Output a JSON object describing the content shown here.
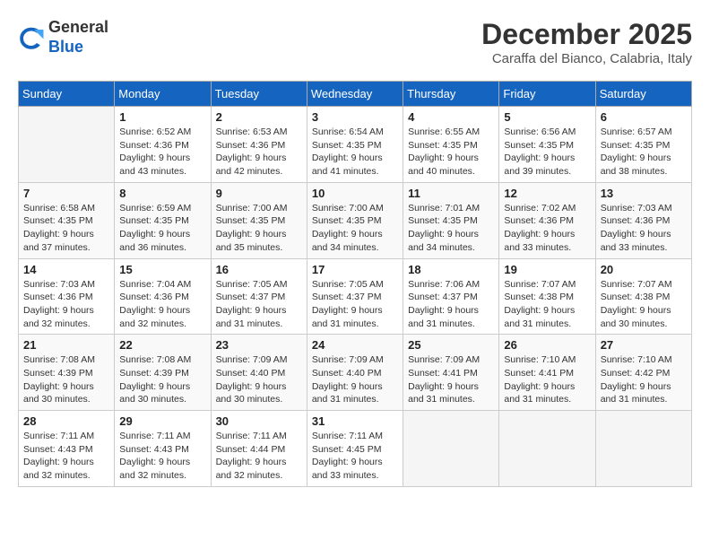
{
  "header": {
    "logo_general": "General",
    "logo_blue": "Blue",
    "month_year": "December 2025",
    "location": "Caraffa del Bianco, Calabria, Italy"
  },
  "weekdays": [
    "Sunday",
    "Monday",
    "Tuesday",
    "Wednesday",
    "Thursday",
    "Friday",
    "Saturday"
  ],
  "weeks": [
    [
      {
        "day": "",
        "info": ""
      },
      {
        "day": "1",
        "info": "Sunrise: 6:52 AM\nSunset: 4:36 PM\nDaylight: 9 hours\nand 43 minutes."
      },
      {
        "day": "2",
        "info": "Sunrise: 6:53 AM\nSunset: 4:36 PM\nDaylight: 9 hours\nand 42 minutes."
      },
      {
        "day": "3",
        "info": "Sunrise: 6:54 AM\nSunset: 4:35 PM\nDaylight: 9 hours\nand 41 minutes."
      },
      {
        "day": "4",
        "info": "Sunrise: 6:55 AM\nSunset: 4:35 PM\nDaylight: 9 hours\nand 40 minutes."
      },
      {
        "day": "5",
        "info": "Sunrise: 6:56 AM\nSunset: 4:35 PM\nDaylight: 9 hours\nand 39 minutes."
      },
      {
        "day": "6",
        "info": "Sunrise: 6:57 AM\nSunset: 4:35 PM\nDaylight: 9 hours\nand 38 minutes."
      }
    ],
    [
      {
        "day": "7",
        "info": "Sunrise: 6:58 AM\nSunset: 4:35 PM\nDaylight: 9 hours\nand 37 minutes."
      },
      {
        "day": "8",
        "info": "Sunrise: 6:59 AM\nSunset: 4:35 PM\nDaylight: 9 hours\nand 36 minutes."
      },
      {
        "day": "9",
        "info": "Sunrise: 7:00 AM\nSunset: 4:35 PM\nDaylight: 9 hours\nand 35 minutes."
      },
      {
        "day": "10",
        "info": "Sunrise: 7:00 AM\nSunset: 4:35 PM\nDaylight: 9 hours\nand 34 minutes."
      },
      {
        "day": "11",
        "info": "Sunrise: 7:01 AM\nSunset: 4:35 PM\nDaylight: 9 hours\nand 34 minutes."
      },
      {
        "day": "12",
        "info": "Sunrise: 7:02 AM\nSunset: 4:36 PM\nDaylight: 9 hours\nand 33 minutes."
      },
      {
        "day": "13",
        "info": "Sunrise: 7:03 AM\nSunset: 4:36 PM\nDaylight: 9 hours\nand 33 minutes."
      }
    ],
    [
      {
        "day": "14",
        "info": "Sunrise: 7:03 AM\nSunset: 4:36 PM\nDaylight: 9 hours\nand 32 minutes."
      },
      {
        "day": "15",
        "info": "Sunrise: 7:04 AM\nSunset: 4:36 PM\nDaylight: 9 hours\nand 32 minutes."
      },
      {
        "day": "16",
        "info": "Sunrise: 7:05 AM\nSunset: 4:37 PM\nDaylight: 9 hours\nand 31 minutes."
      },
      {
        "day": "17",
        "info": "Sunrise: 7:05 AM\nSunset: 4:37 PM\nDaylight: 9 hours\nand 31 minutes."
      },
      {
        "day": "18",
        "info": "Sunrise: 7:06 AM\nSunset: 4:37 PM\nDaylight: 9 hours\nand 31 minutes."
      },
      {
        "day": "19",
        "info": "Sunrise: 7:07 AM\nSunset: 4:38 PM\nDaylight: 9 hours\nand 31 minutes."
      },
      {
        "day": "20",
        "info": "Sunrise: 7:07 AM\nSunset: 4:38 PM\nDaylight: 9 hours\nand 30 minutes."
      }
    ],
    [
      {
        "day": "21",
        "info": "Sunrise: 7:08 AM\nSunset: 4:39 PM\nDaylight: 9 hours\nand 30 minutes."
      },
      {
        "day": "22",
        "info": "Sunrise: 7:08 AM\nSunset: 4:39 PM\nDaylight: 9 hours\nand 30 minutes."
      },
      {
        "day": "23",
        "info": "Sunrise: 7:09 AM\nSunset: 4:40 PM\nDaylight: 9 hours\nand 30 minutes."
      },
      {
        "day": "24",
        "info": "Sunrise: 7:09 AM\nSunset: 4:40 PM\nDaylight: 9 hours\nand 31 minutes."
      },
      {
        "day": "25",
        "info": "Sunrise: 7:09 AM\nSunset: 4:41 PM\nDaylight: 9 hours\nand 31 minutes."
      },
      {
        "day": "26",
        "info": "Sunrise: 7:10 AM\nSunset: 4:41 PM\nDaylight: 9 hours\nand 31 minutes."
      },
      {
        "day": "27",
        "info": "Sunrise: 7:10 AM\nSunset: 4:42 PM\nDaylight: 9 hours\nand 31 minutes."
      }
    ],
    [
      {
        "day": "28",
        "info": "Sunrise: 7:11 AM\nSunset: 4:43 PM\nDaylight: 9 hours\nand 32 minutes."
      },
      {
        "day": "29",
        "info": "Sunrise: 7:11 AM\nSunset: 4:43 PM\nDaylight: 9 hours\nand 32 minutes."
      },
      {
        "day": "30",
        "info": "Sunrise: 7:11 AM\nSunset: 4:44 PM\nDaylight: 9 hours\nand 32 minutes."
      },
      {
        "day": "31",
        "info": "Sunrise: 7:11 AM\nSunset: 4:45 PM\nDaylight: 9 hours\nand 33 minutes."
      },
      {
        "day": "",
        "info": ""
      },
      {
        "day": "",
        "info": ""
      },
      {
        "day": "",
        "info": ""
      }
    ]
  ]
}
